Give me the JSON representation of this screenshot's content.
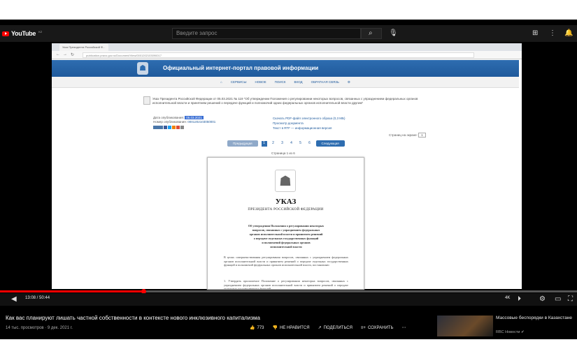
{
  "youtube": {
    "logo": "YouTube",
    "logo_suffix": "KZ",
    "search_placeholder": "Введите запрос"
  },
  "browser": {
    "tab_title": "Указ Президента Российской Ф...",
    "url": "publication.pravo.gov.ru/Document/View/0001202103090017"
  },
  "portal": {
    "title": "Официальный интернет-портал правовой информации",
    "nav": [
      "СЕРВИСЫ",
      "НОВОЕ",
      "ПОИСК",
      "ВХОД",
      "ОБРАТНАЯ СВЯЗЬ"
    ]
  },
  "document": {
    "description": "Указ Президента Российской Федерации от 05.03.2021 № 119 \"Об утверждении Положения о регулировании некоторых вопросов, связанных с упразднением федеральных органов исполнительной власти и принятием решений о передаче функций и полномочий одних федеральных органов исполнительной власти другим\"",
    "published_label": "Дата опубликования:",
    "published_date": "05.03.2021",
    "number_label": "Номер опубликования:",
    "number_value": "0001202103050001",
    "links": [
      "Скачать PDF-файл электронного образа (0,3 МБ)",
      "Просмотр документа",
      "Текст в RTF — информационная версия"
    ],
    "page_view_label": "Страниц на экране:",
    "page_view_value": "1",
    "pager": {
      "prev": "Предыдущая",
      "next": "Следующая",
      "pages": [
        "1",
        "2",
        "3",
        "4",
        "5",
        "6"
      ],
      "count": "Страница 1 из 6"
    }
  },
  "paper": {
    "heading": "УКАЗ",
    "subheading": "ПРЕЗИДЕНТА РОССИЙСКОЙ ФЕДЕРАЦИИ",
    "title_lines": [
      "Об утверждении Положения о регулировании некоторых",
      "вопросов, связанных с упразднением федеральных",
      "органов исполнительной власти и принятием решений",
      "о передаче отдельных государственных функций",
      "и полномочий федеральных органов",
      "исполнительной власти"
    ],
    "para1": "В целях совершенствования регулирования вопросов, связанных с упразднением федеральных органов исполнительной власти и принятием решений о передаче отдельных государственных функций и полномочий федеральных органов исполнительной власти, постановляю:",
    "para2": "1. Утвердить прилагаемое Положение о регулировании некоторых вопросов, связанных с упразднением федеральных органов исполнительной власти и принятием решений о передаче отдельных государственных функций"
  },
  "player": {
    "time": "13:08 / 50:44",
    "time_right": "4K"
  },
  "video": {
    "title": "Как вас планируют лишать частной собственности в контексте нового инклюзивного капитализма",
    "views": "14 тыс. просмотров · 9 дек. 2021 г.",
    "like": "773",
    "dislike": "НЕ НРАВИТСЯ",
    "share": "ПОДЕЛИТЬСЯ",
    "save": "СОХРАНИТЬ"
  },
  "sidebar": {
    "title": "Массовые беспорядки в Казахстане",
    "channel": "RBC Новости",
    "icon": "check-icon"
  }
}
